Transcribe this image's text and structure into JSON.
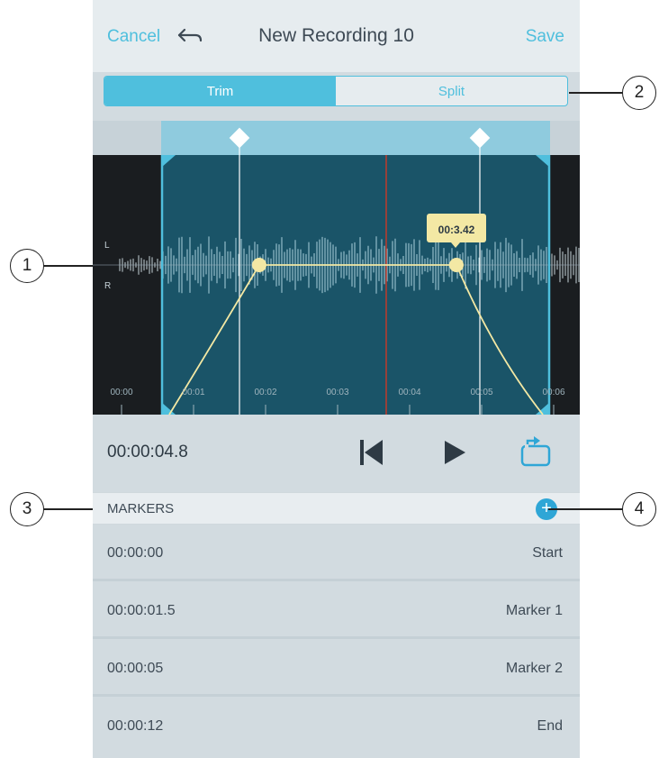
{
  "header": {
    "cancel_label": "Cancel",
    "title": "New Recording 10",
    "save_label": "Save"
  },
  "segmented": {
    "trim_label": "Trim",
    "split_label": "Split",
    "selected": "Trim"
  },
  "waveform": {
    "channel_labels": [
      "L",
      "R"
    ],
    "time_ticks": [
      "00:00",
      "00:01",
      "00:02",
      "00:03",
      "00:04",
      "00:05",
      "00:06"
    ],
    "playhead_tooltip": "00:3.42"
  },
  "transport": {
    "current_time": "00:00:04.8",
    "icons": [
      "skip-to-start-icon",
      "play-icon",
      "loop-icon"
    ]
  },
  "markers": {
    "title": "MARKERS",
    "add_icon": "plus-icon",
    "rows": [
      {
        "time": "00:00:00",
        "label": "Start"
      },
      {
        "time": "00:00:01.5",
        "label": "Marker 1"
      },
      {
        "time": "00:00:05",
        "label": "Marker 2"
      },
      {
        "time": "00:00:12",
        "label": "End"
      }
    ]
  },
  "callouts": [
    "1",
    "2",
    "3",
    "4"
  ],
  "colors": {
    "accent": "#4fbfdd",
    "waveform_bg": "#1a5468",
    "outside_bg": "#1a1d20",
    "playhead": "#c0392b",
    "fade_curve": "#f3e8a4"
  }
}
